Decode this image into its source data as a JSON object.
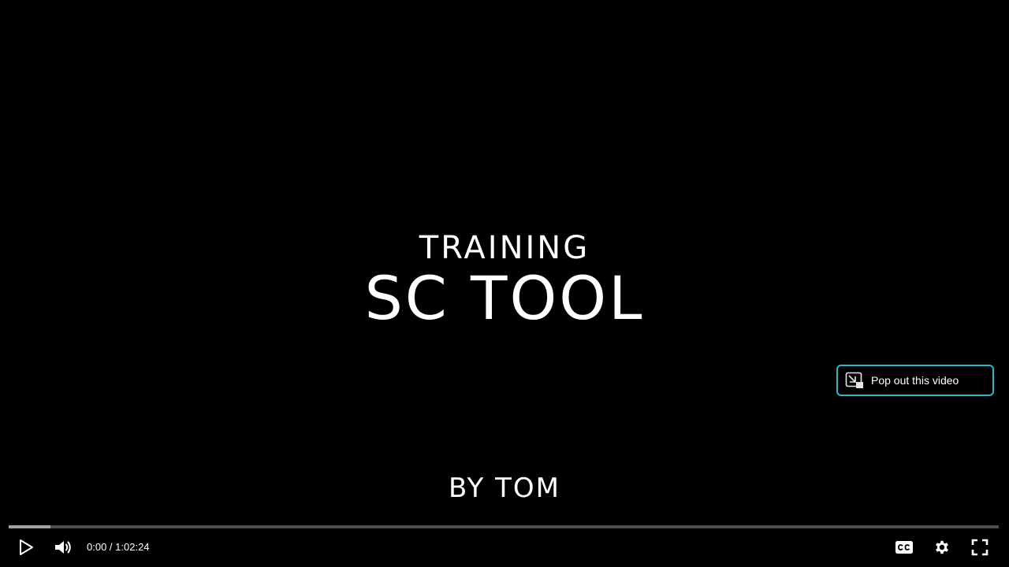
{
  "video": {
    "title_line1": "TRAINING",
    "title_line2": "SC TOOL",
    "byline": "BY TOM"
  },
  "popout": {
    "label": "Pop out this video",
    "icon": "popout-icon",
    "border_color": "#2fb7c7"
  },
  "controls": {
    "current_time": "0:00",
    "separator": " / ",
    "duration": "1:02:24",
    "progress_played_fraction": 0.0,
    "progress_buffered_fraction": 0.042,
    "icons": {
      "play": "play-icon",
      "volume": "volume-icon",
      "captions": "closed-captions-icon",
      "settings": "gear-icon",
      "fullscreen": "fullscreen-icon"
    }
  }
}
